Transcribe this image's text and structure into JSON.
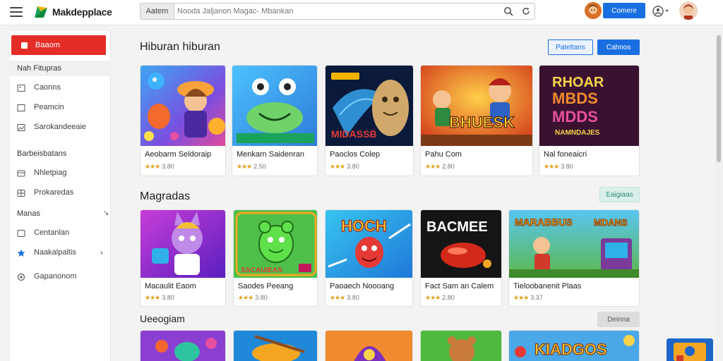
{
  "app": {
    "title": "Makdepplace"
  },
  "search": {
    "category": "Aatem",
    "placeholder": "Nooda Jaljanon Magac- Mbankan"
  },
  "header": {
    "primary_label": "Comere"
  },
  "sidebar": {
    "active_label": "Baaom",
    "section1": "Nah Fitupras",
    "items1": [
      "Caonns",
      "Peamcin",
      "Sarokandeeaie"
    ],
    "section2": "Barbeisbatans",
    "items2": [
      "Nhletpiag",
      "Prokaredas"
    ],
    "section3": "Manas",
    "items3": [
      "Centanlan",
      "Naakalpaltis",
      "Gapanonom"
    ]
  },
  "sections": [
    {
      "title": "Hiburan hiburan",
      "buttons": [
        "Pateltans",
        "Cahnos"
      ],
      "cards": [
        {
          "title": "Aeobarm Seldoraip",
          "rating": "3.80",
          "stars": "★★★"
        },
        {
          "title": "Menkarn Saidenran",
          "rating": "2.50",
          "stars": "★★★"
        },
        {
          "title": "Paoclos Colep",
          "rating": "3.80",
          "stars": "★★★"
        },
        {
          "title": "Pahu Com",
          "rating": "2.80",
          "stars": "★★★"
        },
        {
          "title": "Nal foneaicri",
          "rating": "3.80",
          "stars": "★★★"
        }
      ]
    },
    {
      "title": "Magradas",
      "buttons": [
        "Eaigiaas"
      ],
      "cards": [
        {
          "title": "Macaulit Eaom",
          "rating": "3.80",
          "stars": "★★★"
        },
        {
          "title": "Saodes Peeang",
          "rating": "3.80",
          "stars": "★★★"
        },
        {
          "title": "Paoaech Noooang",
          "rating": "3.80",
          "stars": "★★★"
        },
        {
          "title": "Fact Sam an Calem",
          "rating": "2.80",
          "stars": "★★★"
        },
        {
          "title": "Tieloobanenit Plaas",
          "rating": "3.37",
          "stars": "★★★"
        }
      ]
    },
    {
      "title": "Ueeogiam",
      "buttons": [
        "Deinna"
      ],
      "cards": []
    }
  ],
  "thumb_texts": {
    "t_row1_c2": "MIDASSB",
    "t_row1_c3": "BHUESK",
    "t_row1_c4a": "RHOAR",
    "t_row1_c4b": "MBDS",
    "t_row1_c4c": "MDDS",
    "t_row1_c4d": "NAMNDAJES",
    "t_row2_c3": "HOCH",
    "t_row2_c4": "BACMEE",
    "t_row2_c5a": "MARABBUS",
    "t_row2_c5b": "MDANS",
    "t_row2_c2": "SACAUIEAS",
    "t_row3_c5": "KIADGOS"
  },
  "colors": {
    "accent": "#1a6fe0",
    "active": "#e52d27",
    "star": "#e3a01b"
  }
}
